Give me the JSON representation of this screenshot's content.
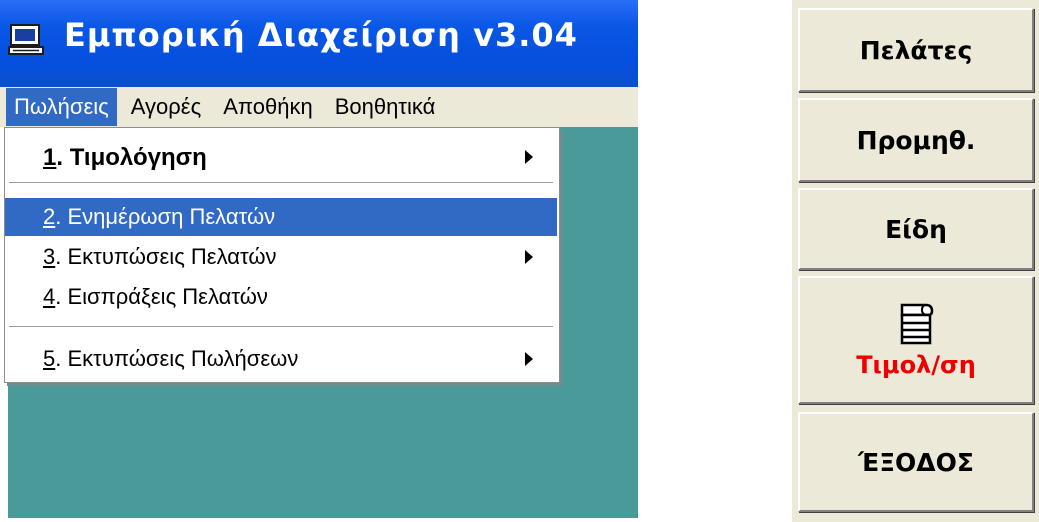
{
  "window": {
    "title": "Εμπορική Διαχείριση v3.04",
    "icon": "computer-icon"
  },
  "menubar": {
    "items": [
      {
        "label": "Πωλήσεις",
        "active": true
      },
      {
        "label": "Αγορές",
        "active": false
      },
      {
        "label": "Αποθήκη",
        "active": false
      },
      {
        "label": "Βοηθητικά",
        "active": false
      }
    ]
  },
  "dropdown": {
    "items": [
      {
        "key": "1",
        "label": ". Τιμολόγηση",
        "submenu": true,
        "bold": true
      },
      {
        "key": "2",
        "label": ". Ενημέρωση Πελατών",
        "submenu": false,
        "highlighted": true
      },
      {
        "key": "3",
        "label": ". Εκτυπώσεις Πελατών",
        "submenu": true
      },
      {
        "key": "4",
        "label": ". Εισπράξεις Πελατών",
        "submenu": false
      },
      {
        "key": "5",
        "label": ". Εκτυπώσεις Πωλήσεων",
        "submenu": true
      }
    ]
  },
  "panel": {
    "buttons": [
      {
        "label": "Πελάτες"
      },
      {
        "label": "Προμηθ."
      },
      {
        "label": "Είδη"
      },
      {
        "label": "Τιμολ/ση",
        "icon": "printer-icon",
        "color": "#ee0000"
      },
      {
        "label": "ΈΞΟΔΟΣ"
      }
    ]
  },
  "colors": {
    "titlebar": "#0550de",
    "menu_highlight": "#316ac5",
    "client_bg": "#4a9a9a",
    "panel_bg": "#ece9d8"
  }
}
